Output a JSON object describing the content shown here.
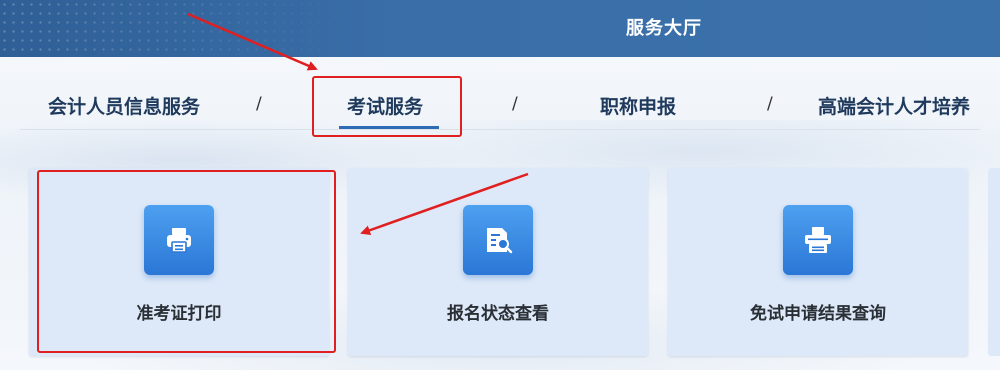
{
  "header": {
    "title": "服务大厅"
  },
  "nav": {
    "tabs": [
      {
        "label": "会计人员信息服务"
      },
      {
        "label": "考试服务"
      },
      {
        "label": "职称申报"
      },
      {
        "label": "高端会计人才培养"
      }
    ],
    "separator": "/"
  },
  "cards": [
    {
      "label": "准考证打印",
      "icon": "printer-icon"
    },
    {
      "label": "报名状态查看",
      "icon": "document-search-icon"
    },
    {
      "label": "免试申请结果查询",
      "icon": "print-queue-icon"
    }
  ],
  "colors": {
    "header_bg": "#3a6ea8",
    "card_bg": "#dde9f8",
    "icon_bg": "#2a77d6",
    "annotation": "#e02020",
    "active_underline": "#2d6bb5"
  }
}
